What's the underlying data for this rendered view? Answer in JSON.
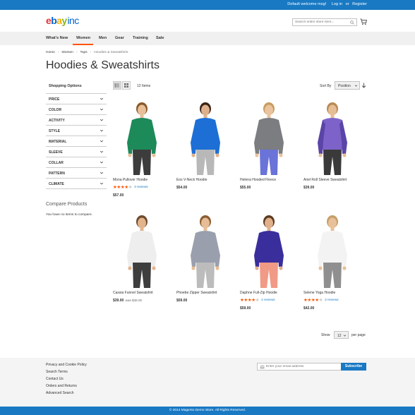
{
  "header": {
    "welcome": "Default welcome msg!",
    "login": "Log in",
    "or": "or",
    "register": "Register",
    "logo": {
      "e": "e",
      "b": "b",
      "a": "a",
      "y": "y",
      "inc": "inc"
    },
    "search_placeholder": "Search entire store here...",
    "colors": {
      "topbar": "#1979c3",
      "accent": "#ff5501"
    }
  },
  "nav": {
    "items": [
      "What's New",
      "Women",
      "Men",
      "Gear",
      "Training",
      "Sale"
    ],
    "active": "Women"
  },
  "breadcrumb": [
    "Home",
    "Women",
    "Tops",
    "Hoodies & Sweatshirts"
  ],
  "page_title": "Hoodies & Sweatshirts",
  "sidebar": {
    "title": "Shopping Options",
    "filters": [
      "PRICE",
      "COLOR",
      "ACTIVITY",
      "STYLE",
      "MATERIAL",
      "SLEEVE",
      "COLLAR",
      "PATTERN",
      "CLIMATE"
    ],
    "compare_title": "Compare Products",
    "compare_empty": "You have no items to compare."
  },
  "toolbar": {
    "items_count": "12",
    "items_label": "Items",
    "sort_label": "Sort By",
    "sort_value": "Position",
    "show_label": "Show",
    "limit_value": "12",
    "per_page": "per page"
  },
  "products": [
    {
      "name": "Mona Pullover Hoodie",
      "rating": 4,
      "reviews": "3 reviews",
      "price": "$57.00",
      "old_price": "",
      "colors": {
        "top": "#1d8a5a",
        "skin": "#e7c09a",
        "hair": "#8a5a2b",
        "pants": "#3c3c3c"
      }
    },
    {
      "name": "Eos V-Neck Hoodie",
      "rating": 0,
      "reviews": "",
      "price": "$54.00",
      "old_price": "",
      "colors": {
        "top": "#1d6fd6",
        "skin": "#dfb08c",
        "hair": "#3a2416",
        "pants": "#b8b8b8"
      }
    },
    {
      "name": "Helena Hooded Fleece",
      "rating": 0,
      "reviews": "",
      "price": "$55.00",
      "old_price": "",
      "colors": {
        "top": "#7b7d80",
        "skin": "#e9c49e",
        "hair": "#c79d5e",
        "pants": "#6a73d8"
      }
    },
    {
      "name": "Ariel Roll Sleeve Sweatshirt",
      "rating": 0,
      "reviews": "",
      "price": "$39.00",
      "old_price": "",
      "colors": {
        "top": "#7d63c9",
        "skin": "#e6be96",
        "hair": "#b98b55",
        "pants": "#3a3a3a"
      }
    },
    {
      "name": "Cassia Funnel Sweatshirt",
      "rating": 0,
      "reviews": "",
      "price": "$39.00",
      "old_price": "was $48.00",
      "colors": {
        "top": "#eeeeee",
        "skin": "#e3b48c",
        "hair": "#6e4a2c",
        "pants": "#3e3e3e"
      }
    },
    {
      "name": "Phoebe Zipper Sweatshirt",
      "rating": 0,
      "reviews": "",
      "price": "$59.00",
      "old_price": "",
      "colors": {
        "top": "#9a9fae",
        "skin": "#e7bd95",
        "hair": "#8b5e34",
        "pants": "#bcbcbc"
      }
    },
    {
      "name": "Daphne Full-Zip Hoodie",
      "rating": 4,
      "reviews": "2 reviews",
      "price": "$59.00",
      "old_price": "",
      "colors": {
        "top": "#3a2e9c",
        "skin": "#e1b08a",
        "hair": "#5b3a22",
        "pants": "#f19a86"
      }
    },
    {
      "name": "Selene Yoga Hoodie",
      "rating": 4,
      "reviews": "3 reviews",
      "price": "$42.00",
      "old_price": "",
      "colors": {
        "top": "#f3f3f3",
        "skin": "#e8c099",
        "hair": "#c6a06a",
        "pants": "#8f8f8f"
      }
    }
  ],
  "footer": {
    "links": [
      "Privacy and Cookie Policy",
      "Search Terms",
      "Contact Us",
      "Orders and Returns",
      "Advanced Search"
    ],
    "newsletter_placeholder": "Enter your email address",
    "subscribe": "Subscribe",
    "copyright": "© 2014 Magento Demo Store. All Rights Reserved."
  }
}
